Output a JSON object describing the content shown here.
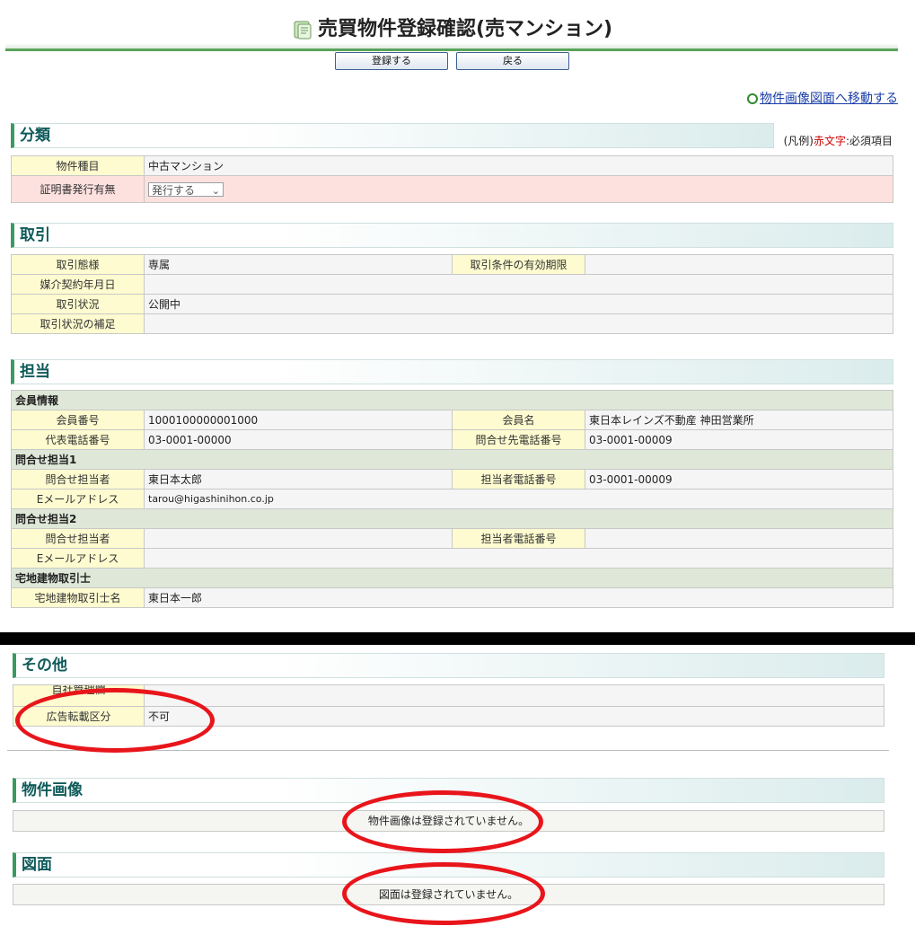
{
  "page": {
    "title": "売買物件登録確認(売マンション)"
  },
  "toolbar": {
    "register_label": "登録する",
    "back_label": "戻る"
  },
  "nav": {
    "image_link": "物件画像図面へ移動する"
  },
  "legend": {
    "prefix": "(凡例)",
    "red_text": "赤文字",
    "suffix": ":必須項目"
  },
  "sections": {
    "bunrui": {
      "title": "分類",
      "property_type_label": "物件種目",
      "property_type_value": "中古マンション",
      "certificate_label": "証明書発行有無",
      "certificate_value": "発行する"
    },
    "torihiki": {
      "title": "取引",
      "mode_label": "取引態様",
      "mode_value": "専属",
      "expiry_label": "取引条件の有効期限",
      "expiry_value": "",
      "contract_date_label": "媒介契約年月日",
      "contract_date_value": "",
      "status_label": "取引状況",
      "status_value": "公開中",
      "status_note_label": "取引状況の補足",
      "status_note_value": ""
    },
    "tanto": {
      "title": "担当",
      "member_info": "会員情報",
      "member_no_label": "会員番号",
      "member_no_value": "1000100000001000",
      "member_name_label": "会員名",
      "member_name_value": "東日本レインズ不動産  神田営業所",
      "rep_phone_label": "代表電話番号",
      "rep_phone_value": "03-0001-00000",
      "inquiry_phone_label": "問合せ先電話番号",
      "inquiry_phone_value": "03-0001-00009",
      "contact1": "問合せ担当1",
      "contact1_person_label": "問合せ担当者",
      "contact1_person_value": "東日本太郎",
      "contact1_phone_label": "担当者電話番号",
      "contact1_phone_value": "03-0001-00009",
      "contact1_email_label": "Eメールアドレス",
      "contact1_email_value": "tarou@higashinihon.co.jp",
      "contact2": "問合せ担当2",
      "contact2_person_label": "問合せ担当者",
      "contact2_person_value": "",
      "contact2_phone_label": "担当者電話番号",
      "contact2_phone_value": "",
      "contact2_email_label": "Eメールアドレス",
      "contact2_email_value": "",
      "broker": "宅地建物取引士",
      "broker_name_label": "宅地建物取引士名",
      "broker_name_value": "東日本一郎"
    },
    "sonota": {
      "title": "その他",
      "row1_label": "自社管理欄",
      "row1_value": "",
      "ad_label": "広告転載区分",
      "ad_value": "不可"
    },
    "images": {
      "title": "物件画像",
      "message": "物件画像は登録されていません。"
    },
    "zumen": {
      "title": "図面",
      "message": "図面は登録されていません。"
    }
  },
  "colors": {
    "annotation_red": "#e8151b",
    "accent_green": "#3a9a63",
    "link_blue": "#1b3fa8"
  }
}
